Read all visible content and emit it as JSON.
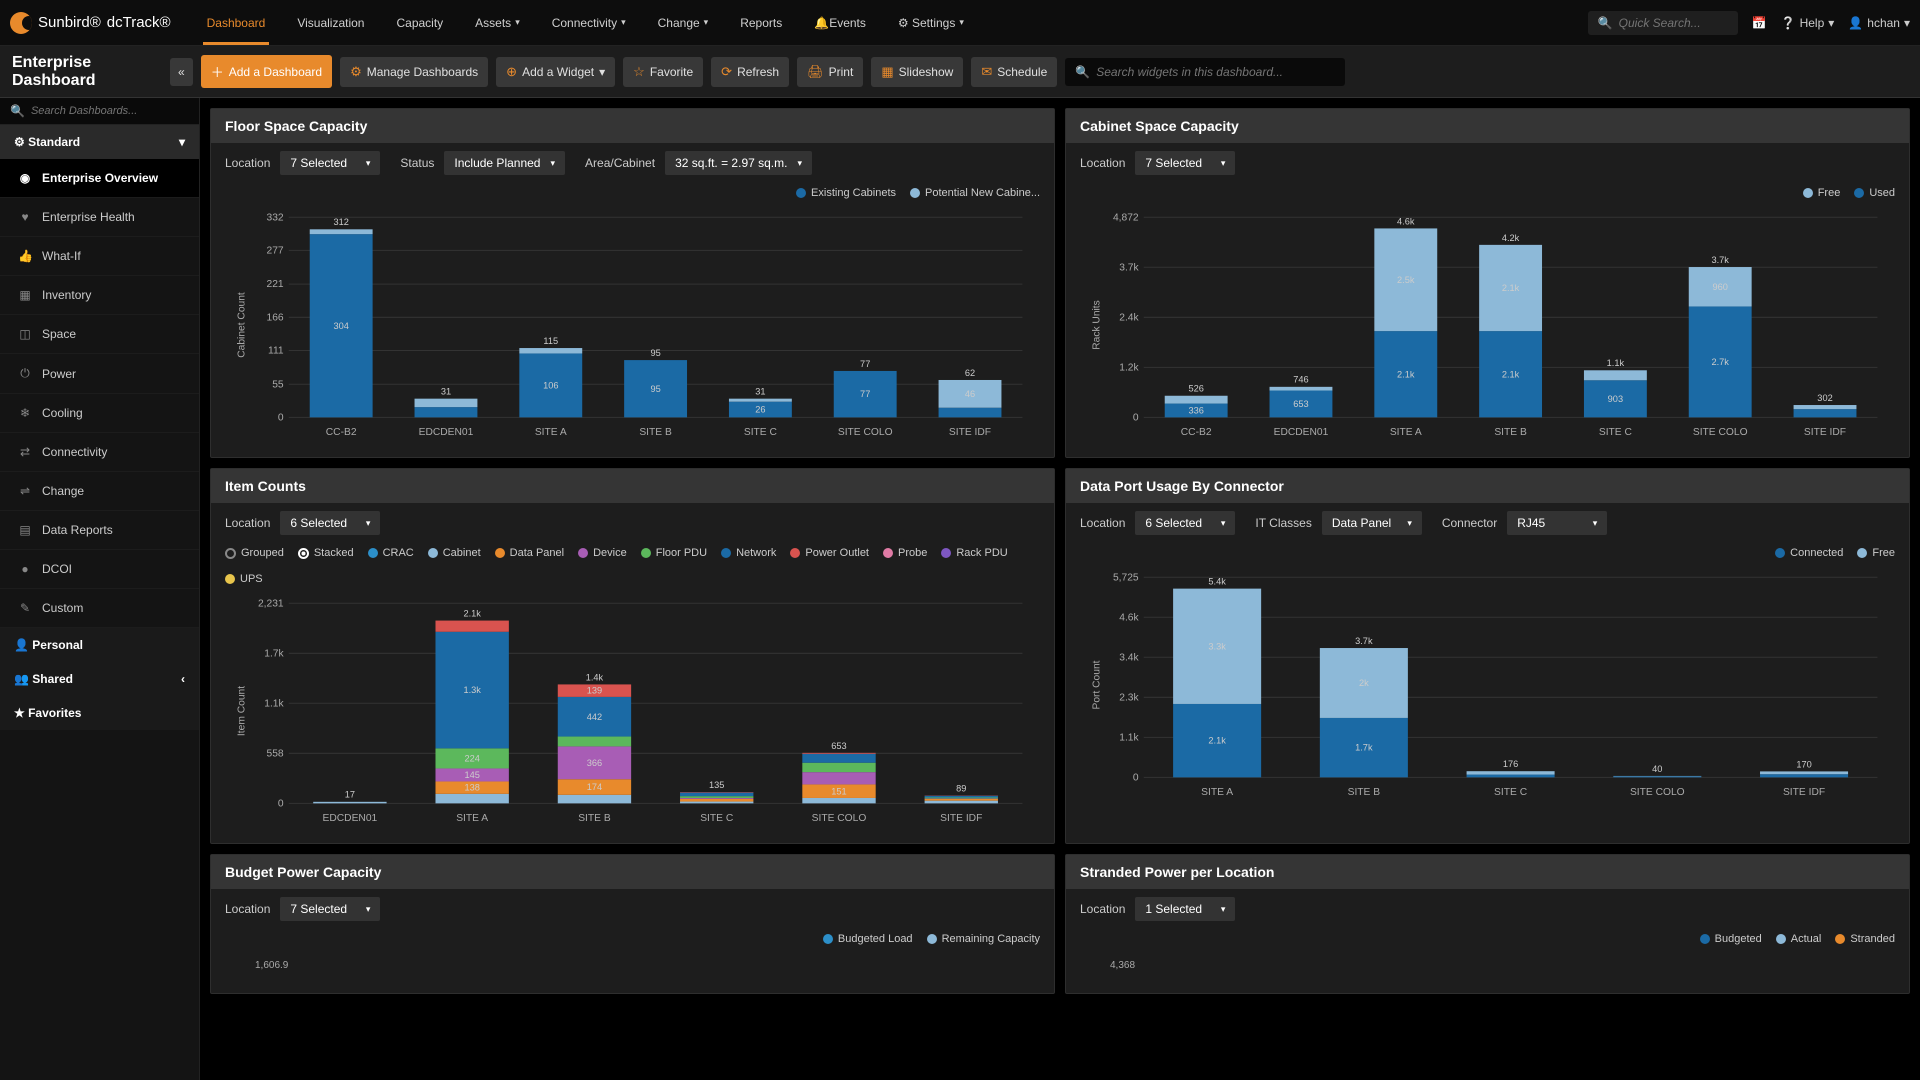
{
  "brand": {
    "company": "Sunbird®",
    "product": "dcTrack®"
  },
  "nav": {
    "items": [
      "Dashboard",
      "Visualization",
      "Capacity",
      "Assets",
      "Connectivity",
      "Change",
      "Reports",
      "Events",
      "Settings"
    ],
    "active": 0,
    "dropdowns": [
      3,
      4,
      5,
      8
    ]
  },
  "navright": {
    "search_placeholder": "Quick Search...",
    "help": "Help",
    "user": "hchan"
  },
  "page_title": "Enterprise Dashboard",
  "toolbar": {
    "add_dash": "Add a Dashboard",
    "manage": "Manage Dashboards",
    "add_widget": "Add a Widget",
    "favorite": "Favorite",
    "refresh": "Refresh",
    "print": "Print",
    "slideshow": "Slideshow",
    "schedule": "Schedule",
    "wsearch_placeholder": "Search widgets in this dashboard..."
  },
  "sidebar": {
    "search_placeholder": "Search Dashboards...",
    "sections": [
      {
        "label": "Standard",
        "open": true,
        "items": [
          {
            "icon": "◉",
            "label": "Enterprise Overview",
            "active": true
          },
          {
            "icon": "♥",
            "label": "Enterprise Health"
          },
          {
            "icon": "👍",
            "label": "What-If"
          },
          {
            "icon": "▦",
            "label": "Inventory"
          },
          {
            "icon": "◫",
            "label": "Space"
          },
          {
            "icon": "⏻",
            "label": "Power"
          },
          {
            "icon": "❄",
            "label": "Cooling"
          },
          {
            "icon": "⇄",
            "label": "Connectivity"
          },
          {
            "icon": "⇌",
            "label": "Change"
          },
          {
            "icon": "▤",
            "label": "Data Reports"
          },
          {
            "icon": "●",
            "label": "DCOI"
          },
          {
            "icon": "✎",
            "label": "Custom"
          }
        ]
      },
      {
        "label": "Personal",
        "icon": "👤"
      },
      {
        "label": "Shared",
        "icon": "👥",
        "caret": true
      },
      {
        "label": "Favorites",
        "icon": "★"
      }
    ]
  },
  "widgets": {
    "floor": {
      "title": "Floor Space Capacity",
      "filters": {
        "location_label": "Location",
        "location_val": "7 Selected",
        "status_label": "Status",
        "status_val": "Include Planned",
        "area_label": "Area/Cabinet",
        "area_val": "32 sq.ft. = 2.97 sq.m."
      },
      "legend": [
        "Existing Cabinets",
        "Potential New Cabine..."
      ],
      "ylabel": "Cabinet Count",
      "max": 332
    },
    "cabinet": {
      "title": "Cabinet Space Capacity",
      "filters": {
        "location_label": "Location",
        "location_val": "7 Selected"
      },
      "legend": [
        "Free",
        "Used"
      ],
      "ylabel": "Rack Units",
      "max": 4872
    },
    "items": {
      "title": "Item Counts",
      "filters": {
        "location_label": "Location",
        "location_val": "6 Selected"
      },
      "modes": [
        "Grouped",
        "Stacked"
      ],
      "legend": [
        "CRAC",
        "Cabinet",
        "Data Panel",
        "Device",
        "Floor PDU",
        "Network",
        "Power Outlet",
        "Probe",
        "Rack PDU",
        "UPS"
      ],
      "ylabel": "Item Count",
      "max": 2231
    },
    "dataport": {
      "title": "Data Port Usage By Connector",
      "filters": {
        "location_label": "Location",
        "location_val": "6 Selected",
        "class_label": "IT Classes",
        "class_val": "Data Panel",
        "conn_label": "Connector",
        "conn_val": "RJ45"
      },
      "legend": [
        "Connected",
        "Free"
      ],
      "ylabel": "Port Count",
      "max": 5725
    },
    "budget": {
      "title": "Budget Power Capacity",
      "filters": {
        "location_label": "Location",
        "location_val": "7 Selected"
      },
      "legend": [
        "Budgeted Load",
        "Remaining Capacity"
      ],
      "max": 1606.9
    },
    "stranded": {
      "title": "Stranded Power per Location",
      "filters": {
        "location_label": "Location",
        "location_val": "1 Selected"
      },
      "legend": [
        "Budgeted",
        "Actual",
        "Stranded"
      ],
      "max": 4368
    }
  },
  "chart_data": [
    {
      "id": "floor",
      "type": "bar",
      "ylabel": "Cabinet Count",
      "ylim": [
        0,
        332
      ],
      "categories": [
        "CC-B2",
        "EDCDEN01",
        "SITE A",
        "SITE B",
        "SITE C",
        "SITE COLO",
        "SITE IDF"
      ],
      "series": [
        {
          "name": "Existing Cabinets",
          "values": [
            304,
            17,
            106,
            95,
            26,
            77,
            16
          ],
          "color": "#1b6aa5"
        },
        {
          "name": "Potential New Cabinets",
          "values": [
            8,
            14,
            9,
            0,
            5,
            0,
            46
          ],
          "color": "#8db9d8"
        }
      ],
      "totals": [
        312,
        31,
        115,
        95,
        31,
        77,
        62
      ]
    },
    {
      "id": "cabinet",
      "type": "bar",
      "ylabel": "Rack Units",
      "ylim": [
        0,
        4872
      ],
      "categories": [
        "CC-B2",
        "EDCDEN01",
        "SITE A",
        "SITE B",
        "SITE C",
        "SITE COLO",
        "SITE IDF"
      ],
      "series": [
        {
          "name": "Used",
          "values": [
            336,
            653,
            2100,
            2100,
            903,
            2700,
            200
          ],
          "color": "#1b6aa5"
        },
        {
          "name": "Free",
          "values": [
            190,
            90,
            2500,
            2100,
            243,
            960,
            100
          ],
          "color": "#8db9d8"
        }
      ],
      "totals": [
        526,
        746,
        4600,
        4200,
        1146,
        3700,
        302
      ]
    },
    {
      "id": "items",
      "type": "bar",
      "mode": "stacked",
      "ylabel": "Item Count",
      "ylim": [
        0,
        2231
      ],
      "categories": [
        "EDCDEN01",
        "SITE A",
        "SITE B",
        "SITE C",
        "SITE COLO",
        "SITE IDF"
      ],
      "series": [
        {
          "name": "CRAC",
          "color": "#2c8fc9"
        },
        {
          "name": "Cabinet",
          "color": "#8db9d8",
          "values": [
            17,
            106,
            95,
            20,
            60,
            30
          ]
        },
        {
          "name": "Data Panel",
          "color": "#e88a2c",
          "values": [
            0,
            138,
            174,
            30,
            151,
            20
          ]
        },
        {
          "name": "Device",
          "color": "#a85db5",
          "values": [
            0,
            145,
            366,
            10,
            137,
            5
          ]
        },
        {
          "name": "Floor PDU",
          "color": "#5cb85c",
          "values": [
            0,
            224,
            110,
            20,
            105,
            10
          ]
        },
        {
          "name": "Network",
          "color": "#1b6aa5",
          "values": [
            0,
            1300,
            442,
            40,
            100,
            20
          ]
        },
        {
          "name": "Power Outlet",
          "color": "#d9534f",
          "values": [
            0,
            125,
            139,
            5,
            10,
            3
          ]
        },
        {
          "name": "Probe",
          "color": "#e07ba5"
        },
        {
          "name": "Rack PDU",
          "color": "#7e57c2"
        },
        {
          "name": "UPS",
          "color": "#e8c54c"
        }
      ],
      "totals": [
        17,
        2100,
        1440,
        135,
        653,
        89
      ],
      "visible_labels": {
        "SITE A": [
          "106",
          "138",
          "1.3k",
          "224",
          "125",
          "145"
        ],
        "SITE B": [
          "95",
          "174",
          "442",
          "110",
          "139",
          "366"
        ],
        "SITE COLO": [
          "151",
          "105",
          "137"
        ]
      }
    },
    {
      "id": "dataport",
      "type": "bar",
      "ylabel": "Port Count",
      "ylim": [
        0,
        5725
      ],
      "categories": [
        "SITE A",
        "SITE B",
        "SITE C",
        "SITE COLO",
        "SITE IDF"
      ],
      "series": [
        {
          "name": "Connected",
          "values": [
            2100,
            1700,
            80,
            30,
            90
          ],
          "color": "#1b6aa5"
        },
        {
          "name": "Free",
          "values": [
            3300,
            2000,
            96,
            10,
            80
          ],
          "color": "#8db9d8"
        }
      ],
      "totals": [
        5400,
        3700,
        176,
        40,
        170
      ]
    },
    {
      "id": "budget",
      "type": "bar",
      "ylim": [
        0,
        1606.9
      ],
      "series": [
        {
          "name": "Budgeted Load"
        },
        {
          "name": "Remaining Capacity"
        }
      ]
    },
    {
      "id": "stranded",
      "type": "bar",
      "ylim": [
        0,
        4368
      ],
      "series": [
        {
          "name": "Budgeted"
        },
        {
          "name": "Actual"
        },
        {
          "name": "Stranded"
        }
      ]
    }
  ]
}
